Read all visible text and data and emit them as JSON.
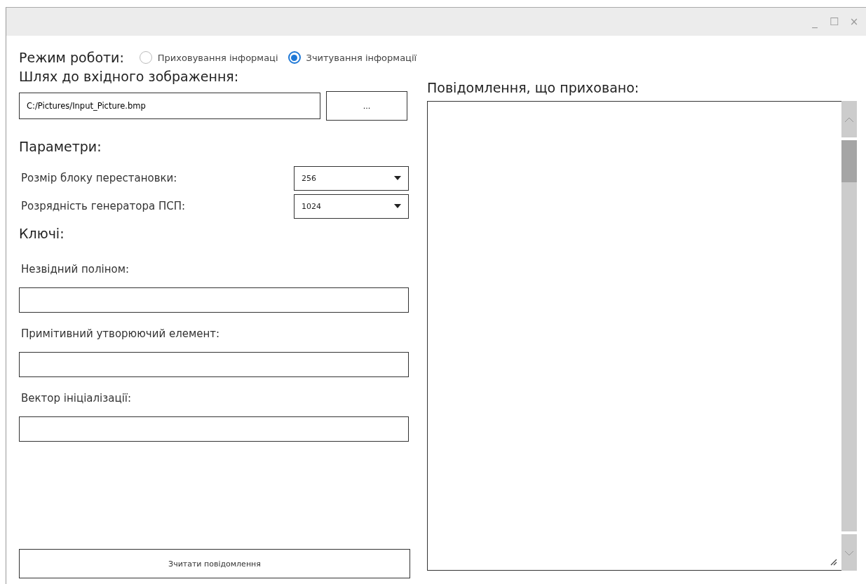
{
  "window": {
    "controls": [
      "_",
      "☐",
      "×"
    ]
  },
  "mode": {
    "label": "Режим роботи:",
    "options": [
      {
        "label": "Приховування інформаці",
        "selected": false
      },
      {
        "label": "Зчитування інформації",
        "selected": true
      }
    ]
  },
  "input_path": {
    "label": "Шлях до вхідного зображення:",
    "value": "C:/Pictures/Input_Picture.bmp",
    "browse_button": "..."
  },
  "parameters": {
    "title": "Параметри:",
    "rows": [
      {
        "label": "Розмір блоку перестановки:",
        "value": "256"
      },
      {
        "label": "Розрядність генератора ПСП:",
        "value": "1024"
      }
    ]
  },
  "keys": {
    "title": "Ключі:",
    "fields": [
      {
        "label": "Незвідний поліном:"
      },
      {
        "label": "Примітивний утворюючий елемент:"
      },
      {
        "label": "Вектор ініціалізації:"
      }
    ]
  },
  "action_button": "Зчитати повідомлення",
  "message": {
    "label": "Повідомлення, що приховано:"
  }
}
